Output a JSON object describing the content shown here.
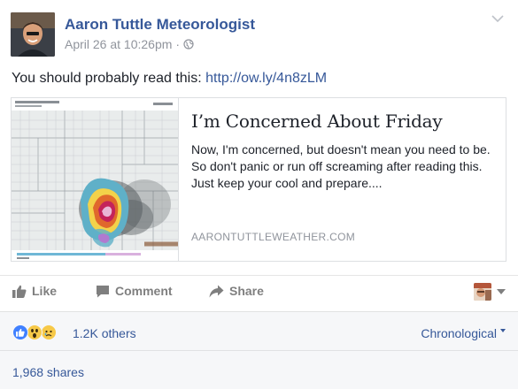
{
  "post": {
    "author": "Aaron Tuttle Meteorologist",
    "timestamp": "April 26 at 10:26pm",
    "separator": "·",
    "privacy_icon": "globe-icon",
    "text_prefix": "You should probably read this: ",
    "link_url": "http://ow.ly/4n8zLM"
  },
  "link_preview": {
    "title": "I’m Concerned About Friday",
    "description": "Now, I'm concerned, but doesn't mean you need to be. So don't panic or run off screaming after reading this. Just keep your cool and prepare....",
    "domain": "AARONTUTTLEWEATHER.COM"
  },
  "actions": {
    "like_label": "Like",
    "comment_label": "Comment",
    "share_label": "Share"
  },
  "reactions": {
    "icons": [
      "like-icon",
      "wow-icon",
      "sad-icon"
    ],
    "count_label": "1.2K others",
    "sort_label": "Chronological"
  },
  "shares": {
    "label": "1,968 shares"
  },
  "colors": {
    "link_blue": "#365899",
    "muted_gray": "#90949c",
    "action_gray": "#7f7f7f",
    "footer_bg": "#f6f7f9",
    "like_blue": "#4080ff",
    "reaction_yellow": "#f7c948"
  }
}
